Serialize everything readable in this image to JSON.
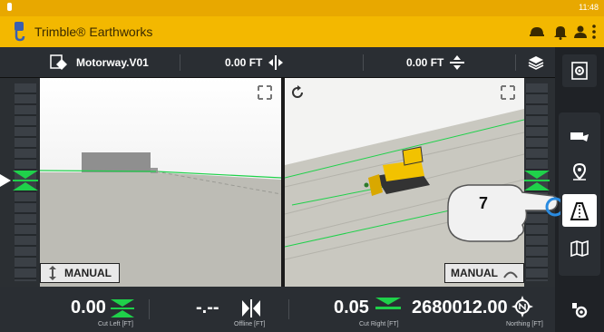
{
  "status": {
    "time": "11:48"
  },
  "app": {
    "title": "Trimble® Earthworks"
  },
  "info": {
    "design": "Motorway.V01",
    "cut_value": "0.00 FT",
    "vertical_value": "0.00 FT"
  },
  "views": {
    "left_mode": "MANUAL",
    "right_mode": "MANUAL"
  },
  "bottom": {
    "cut_left": {
      "value": "0.00",
      "label": "Cut Left [FT]"
    },
    "offline": {
      "value": "-.--",
      "label": "Offline [FT]"
    },
    "cut_right": {
      "value": "0.05",
      "label": "Cut Right [FT]"
    },
    "northing": {
      "value": "2680012.00",
      "label": "Northing [FT]"
    }
  },
  "callout": {
    "step": "7"
  },
  "colors": {
    "accent": "#f3b800",
    "ontarget": "#1fd14a",
    "panel": "#2a2e33",
    "active_ring": "#2a8be0"
  },
  "icons": [
    "trimble-logo-icon",
    "helmet-icon",
    "bell-icon",
    "user-icon",
    "more-vert-icon",
    "design-icon",
    "horizontal-offset-icon",
    "vertical-offset-icon",
    "layers-icon",
    "settings-gear-icon",
    "truck-icon",
    "location-icon",
    "view-mode-icon",
    "map-icon",
    "machine-settings-icon",
    "expand-icon",
    "rotate-icon",
    "blade-icon"
  ]
}
